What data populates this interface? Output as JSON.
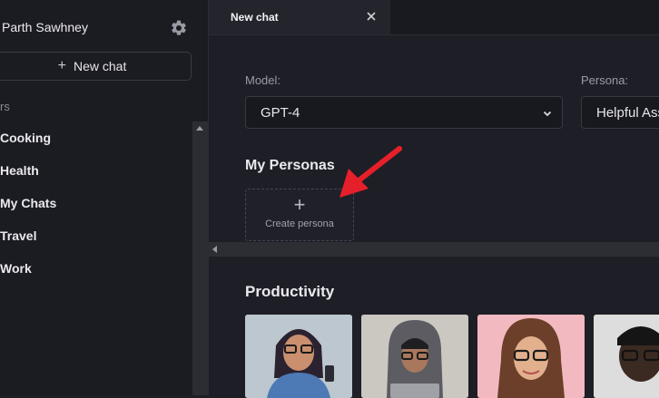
{
  "sidebar": {
    "user_name": "Parth Sawhney",
    "new_chat_label": "New chat",
    "section_label": "rs",
    "folders": [
      "Cooking",
      "Health",
      "My Chats",
      "Travel",
      "Work"
    ]
  },
  "tabs": [
    {
      "label": "New chat"
    }
  ],
  "main": {
    "model_label": "Model:",
    "model_value": "GPT-4",
    "persona_label": "Persona:",
    "persona_value": "Helpful Assistant",
    "my_personas_heading": "My Personas",
    "create_persona_label": "Create persona",
    "productivity_heading": "Productivity"
  },
  "colors": {
    "annotation_arrow": "#e5202a"
  },
  "icons": [
    "gear-icon",
    "plus-icon",
    "close-icon",
    "chevron-down-icon"
  ]
}
